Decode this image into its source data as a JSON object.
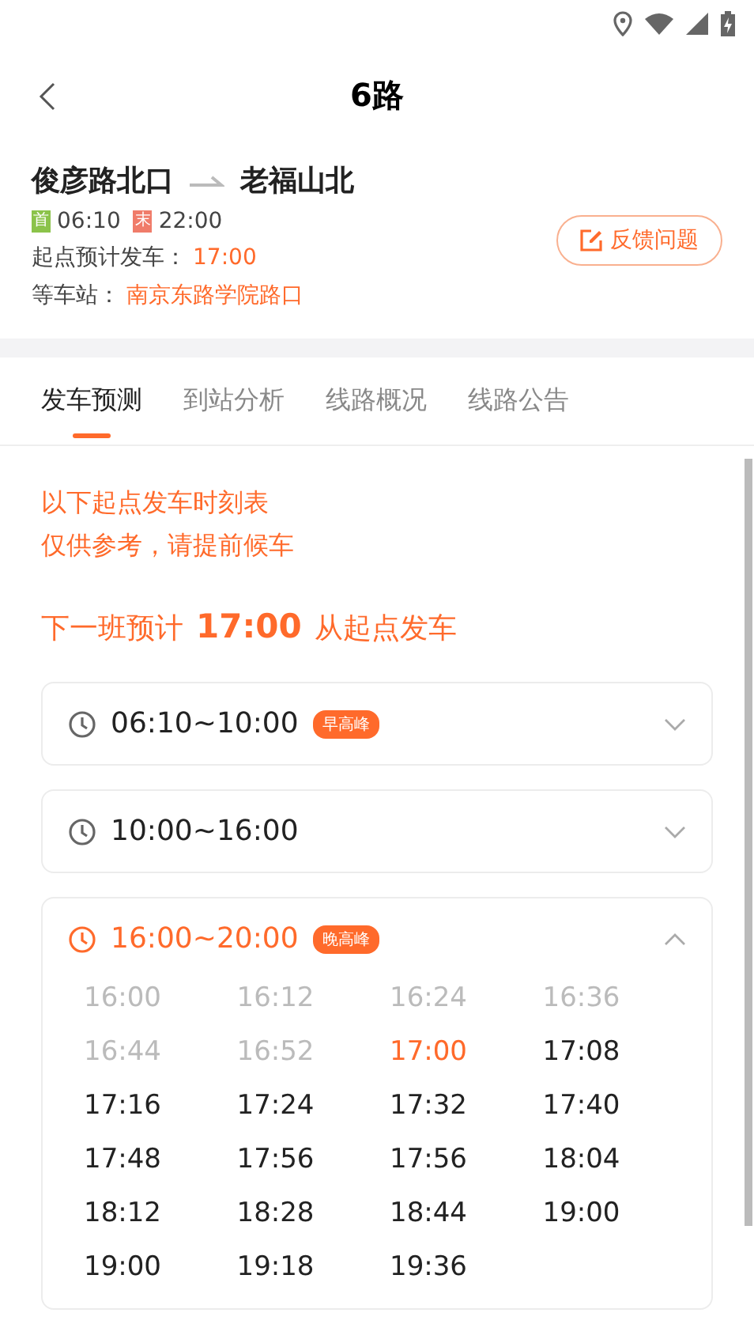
{
  "header": {
    "title": "6路"
  },
  "route": {
    "from": "俊彦路北口",
    "to": "老福山北",
    "first_label": "首",
    "first_time": "06:10",
    "last_label": "末",
    "last_time": "22:00",
    "departure_label": "起点预计发车：",
    "departure_time": "17:00",
    "station_label": "等车站：",
    "station": "南京东路学院路口",
    "feedback": "反馈问题"
  },
  "tabs": [
    {
      "label": "发车预测",
      "selected": true
    },
    {
      "label": "到站分析",
      "selected": false
    },
    {
      "label": "线路概况",
      "selected": false
    },
    {
      "label": "线路公告",
      "selected": false
    }
  ],
  "notice": [
    "以下起点发车时刻表",
    "仅供参考，请提前候车"
  ],
  "next": {
    "prefix": "下一班预计",
    "time": "17:00",
    "suffix": "从起点发车"
  },
  "periods": [
    {
      "range": "06:10~10:00",
      "badge": "早高峰",
      "expanded": false
    },
    {
      "range": "10:00~16:00",
      "expanded": false
    },
    {
      "range": "16:00~20:00",
      "badge": "晚高峰",
      "expanded": true,
      "times": [
        {
          "time": "16:00",
          "departed": true,
          "next": false
        },
        {
          "time": "16:12",
          "departed": true,
          "next": false
        },
        {
          "time": "16:24",
          "departed": true,
          "next": false
        },
        {
          "time": "16:36",
          "departed": true,
          "next": false
        },
        {
          "time": "16:44",
          "departed": true,
          "next": false
        },
        {
          "time": "16:52",
          "departed": true,
          "next": false
        },
        {
          "time": "17:00",
          "departed": false,
          "next": true
        },
        {
          "time": "17:08",
          "departed": false,
          "next": false
        },
        {
          "time": "17:16",
          "departed": false,
          "next": false
        },
        {
          "time": "17:24",
          "departed": false,
          "next": false
        },
        {
          "time": "17:32",
          "departed": false,
          "next": false
        },
        {
          "time": "17:40",
          "departed": false,
          "next": false
        },
        {
          "time": "17:48",
          "departed": false,
          "next": false
        },
        {
          "time": "17:56",
          "departed": false,
          "next": false
        },
        {
          "time": "17:56",
          "departed": false,
          "next": false
        },
        {
          "time": "18:04",
          "departed": false,
          "next": false
        },
        {
          "time": "18:12",
          "departed": false,
          "next": false
        },
        {
          "time": "18:28",
          "departed": false,
          "next": false
        },
        {
          "time": "18:44",
          "departed": false,
          "next": false
        },
        {
          "time": "19:00",
          "departed": false,
          "next": false
        },
        {
          "time": "19:00",
          "departed": false,
          "next": false
        },
        {
          "time": "19:18",
          "departed": false,
          "next": false
        },
        {
          "time": "19:36",
          "departed": false,
          "next": false
        }
      ]
    }
  ]
}
